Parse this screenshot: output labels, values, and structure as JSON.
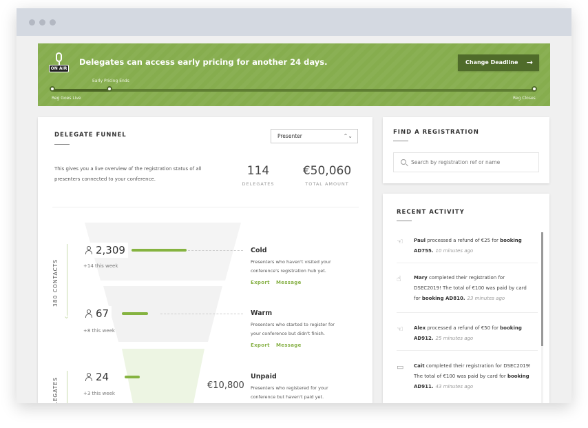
{
  "colors": {
    "accent": "#86ad4e",
    "accent_dark": "#4f6b2a",
    "bar": "#85b340",
    "link": "#86b045"
  },
  "banner": {
    "badge": "ON AIR",
    "message": "Delegates can access early pricing for another 24 days.",
    "button_label": "Change Deadline",
    "button_icon": "arrow-right-icon",
    "timeline": {
      "start_label": "Reg Goes Live",
      "middle_label": "Early Pricing Ends",
      "end_label": "Reg Closes"
    }
  },
  "funnel": {
    "title": "DELEGATE FUNNEL",
    "select_value": "Presenter",
    "description": "This gives you a live overview of the registration status of all presenters connected to your conference.",
    "stats": [
      {
        "value": "114",
        "label": "DELEGATES"
      },
      {
        "value": "€50,060",
        "label": "TOTAL AMOUNT"
      }
    ],
    "side_label": "380 CONTACTS",
    "side_label_2": "DELEGATES",
    "stages": [
      {
        "count": "2,309",
        "week": "+14 this week",
        "title": "Cold",
        "description": "Presenters who haven't visited your conference's registration hub yet.",
        "export": "Export",
        "message": "Message",
        "amount": "",
        "bar_fraction": 1.0
      },
      {
        "count": "67",
        "week": "+8 this week",
        "title": "Warm",
        "description": "Presenters who started to register for your conference but didn't finish.",
        "export": "Export",
        "message": "Message",
        "amount": "",
        "bar_fraction": 0.48
      },
      {
        "count": "24",
        "week": "+3 this week",
        "title": "Unpaid",
        "description": "Presenters who registered for your conference but haven't paid yet.",
        "export": "",
        "message": "",
        "amount": "€10,800",
        "bar_fraction": 0.27
      }
    ]
  },
  "find": {
    "title": "FIND A REGISTRATION",
    "placeholder": "Search by registration ref or name"
  },
  "recent": {
    "title": "RECENT ACTIVITY",
    "items": [
      {
        "icon": "refund-hand-icon",
        "name": "Paul",
        "text": " processed a refund of €25 for ",
        "bold": "booking AD755.",
        "time": "10 minutes ago"
      },
      {
        "icon": "registration-hand-icon",
        "name": "Mary",
        "text": " completed their registration for DSEC2019! The total of €100 was paid by card for ",
        "bold": "booking AD810.",
        "time": "23 minutes ago"
      },
      {
        "icon": "refund-hand-icon",
        "name": "Alex",
        "text": " processed a refund of €50 for ",
        "bold": "booking AD912.",
        "time": "25 minutes ago"
      },
      {
        "icon": "credit-card-icon",
        "name": "Cait",
        "text": " completed their registration for DSEC2019! The total of €100 was paid by card for ",
        "bold": "booking AD911.",
        "time": "43 minutes ago"
      }
    ]
  }
}
